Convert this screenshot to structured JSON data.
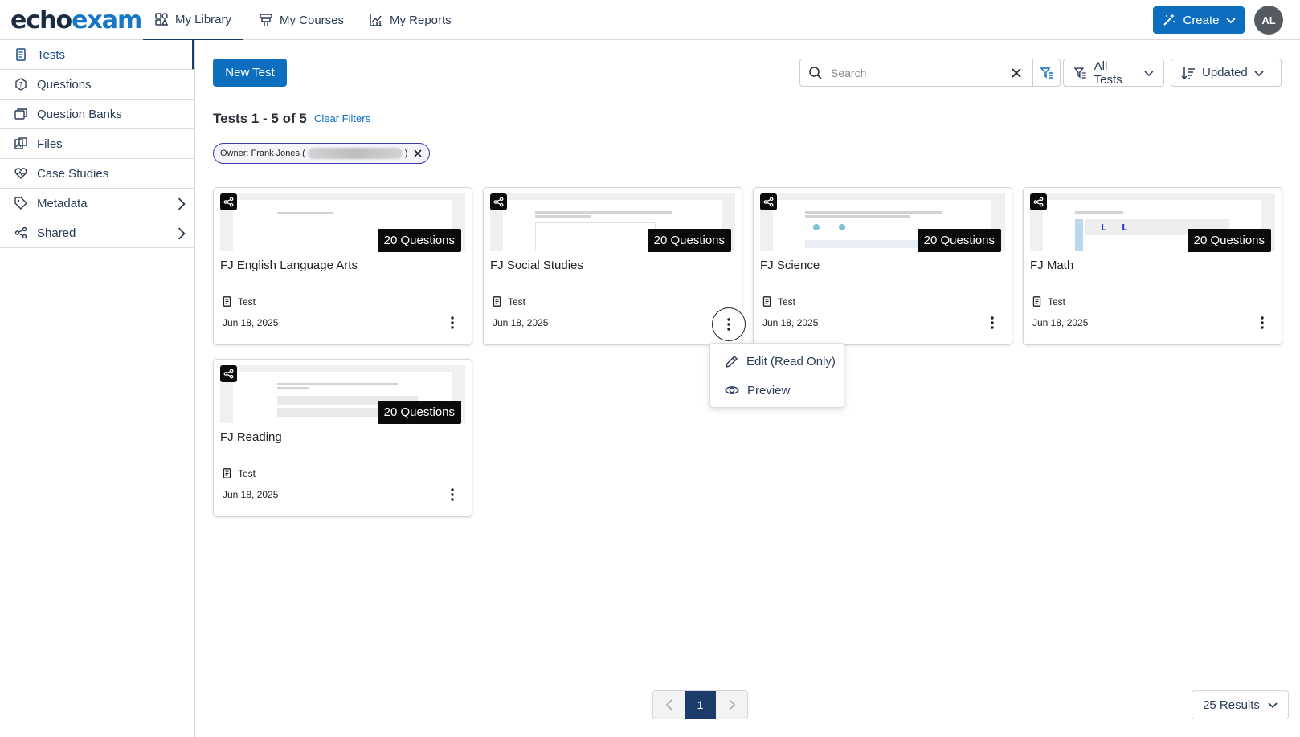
{
  "app": {
    "logo_echo": "echo",
    "logo_exam": "exam"
  },
  "nav": {
    "tabs": [
      {
        "label": "My Library",
        "icon": "library-icon",
        "active": true
      },
      {
        "label": "My Courses",
        "icon": "courses-icon"
      },
      {
        "label": "My Reports",
        "icon": "reports-icon"
      }
    ],
    "create_label": "Create",
    "avatar_initials": "AL"
  },
  "sidebar": {
    "items": [
      {
        "label": "Tests",
        "icon": "test-doc-icon",
        "active": true
      },
      {
        "label": "Questions",
        "icon": "question-icon"
      },
      {
        "label": "Question Banks",
        "icon": "question-banks-icon"
      },
      {
        "label": "Files",
        "icon": "files-icon"
      },
      {
        "label": "Case Studies",
        "icon": "case-studies-icon"
      },
      {
        "label": "Metadata",
        "icon": "tag-icon",
        "has_submenu": true
      },
      {
        "label": "Shared",
        "icon": "share-icon",
        "has_submenu": true
      }
    ]
  },
  "toolbar": {
    "new_test_label": "New Test",
    "search_placeholder": "Search",
    "search_value": "",
    "filter_label": "All Tests",
    "sort_label": "Updated"
  },
  "summary": {
    "count_text": "Tests 1 - 5 of 5",
    "clear_filters": "Clear Filters",
    "chip_owner_prefix": "Owner: Frank Jones (",
    "chip_owner_suffix": ")"
  },
  "cards": [
    {
      "title": "FJ English Language Arts",
      "questions": "20 Questions",
      "type": "Test",
      "date": "Jun 18, 2025"
    },
    {
      "title": "FJ Social Studies",
      "questions": "20 Questions",
      "type": "Test",
      "date": "Jun 18, 2025"
    },
    {
      "title": "FJ Science",
      "questions": "20 Questions",
      "type": "Test",
      "date": "Jun 18, 2025"
    },
    {
      "title": "FJ Math",
      "questions": "20 Questions",
      "type": "Test",
      "date": "Jun 18, 2025"
    },
    {
      "title": "FJ Reading",
      "questions": "20 Questions",
      "type": "Test",
      "date": "Jun 18, 2025"
    }
  ],
  "context_menu": {
    "items": [
      {
        "label": "Edit (Read Only)",
        "icon": "pencil-icon"
      },
      {
        "label": "Preview",
        "icon": "eye-icon"
      }
    ]
  },
  "pagination": {
    "current_page": "1",
    "results_label": "25 Results"
  },
  "colors": {
    "primary": "#0d6ec0",
    "navy": "#1c3d6b",
    "badge": "#0b0b0b"
  }
}
